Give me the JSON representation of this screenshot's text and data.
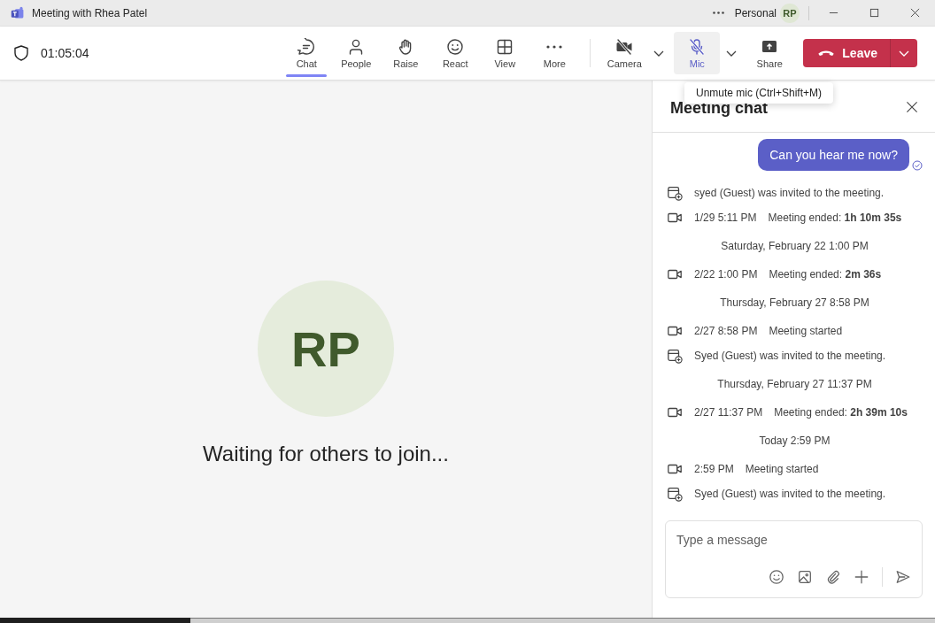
{
  "window": {
    "title": "Meeting with Rhea Patel",
    "account": "Personal",
    "account_initials": "RP"
  },
  "toolbar": {
    "timer": "01:05:04",
    "buttons": [
      {
        "label": "Chat",
        "kind": "chat",
        "selected": true
      },
      {
        "label": "People",
        "kind": "people",
        "selected": false
      },
      {
        "label": "Raise",
        "kind": "raise",
        "selected": false
      },
      {
        "label": "React",
        "kind": "react",
        "selected": false
      },
      {
        "label": "View",
        "kind": "view",
        "selected": false
      },
      {
        "label": "More",
        "kind": "more",
        "selected": false
      }
    ],
    "devices": [
      {
        "label": "Camera",
        "kind": "camera",
        "on": false,
        "highlighted": false
      },
      {
        "label": "Mic",
        "kind": "mic",
        "on": false,
        "highlighted": true
      }
    ],
    "share": "Share",
    "leave": "Leave"
  },
  "tooltip": "Unmute mic (Ctrl+Shift+M)",
  "stage": {
    "initials": "RP",
    "status": "Waiting for others to join..."
  },
  "chat": {
    "title": "Meeting chat",
    "messages": [
      {
        "kind": "bubble",
        "text": "Can you hear me now?"
      },
      {
        "kind": "invite",
        "text": "syed (Guest) was invited to the meeting."
      },
      {
        "kind": "call",
        "time": "1/29 5:11 PM",
        "text": "Meeting ended: **1h 10m 35s**"
      },
      {
        "kind": "date",
        "text": "Saturday, February 22 1:00 PM"
      },
      {
        "kind": "call",
        "time": "2/22 1:00 PM",
        "text": "Meeting ended: **2m 36s**"
      },
      {
        "kind": "date",
        "text": "Thursday, February 27 8:58 PM"
      },
      {
        "kind": "call",
        "time": "2/27 8:58 PM",
        "text": "Meeting started"
      },
      {
        "kind": "invite",
        "text": "Syed (Guest) was invited to the meeting."
      },
      {
        "kind": "date",
        "text": "Thursday, February 27 11:37 PM"
      },
      {
        "kind": "call",
        "time": "2/27 11:37 PM",
        "text": "Meeting ended: **2h 39m 10s**"
      },
      {
        "kind": "date",
        "text": "Today 2:59 PM"
      },
      {
        "kind": "call",
        "time": "2:59 PM",
        "text": "Meeting started"
      },
      {
        "kind": "invite",
        "text": "Syed (Guest) was invited to the meeting."
      }
    ],
    "composer": {
      "placeholder": "Type a message"
    }
  }
}
